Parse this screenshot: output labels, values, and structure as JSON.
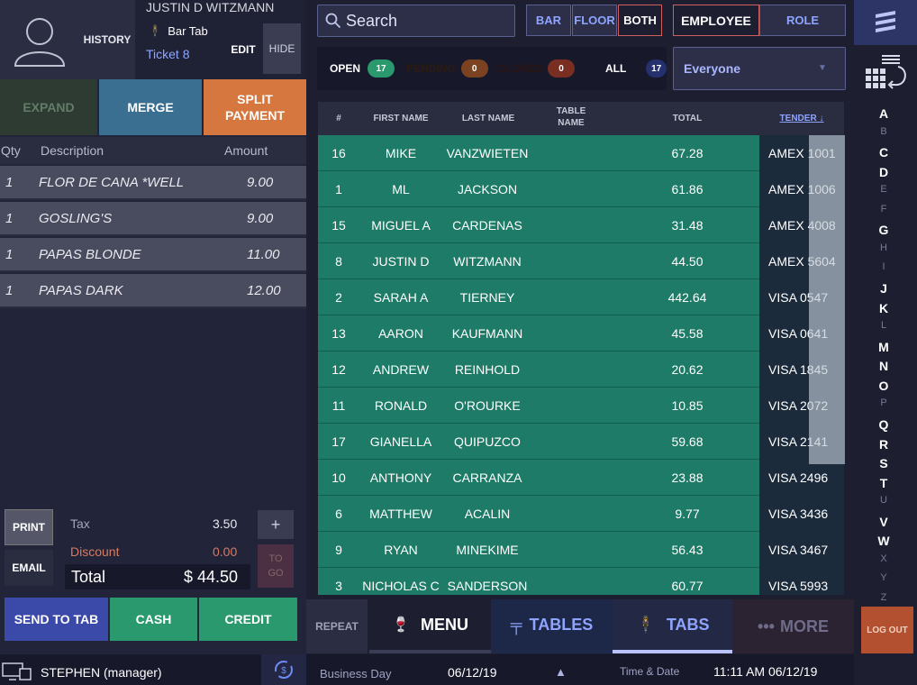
{
  "customer": {
    "name": "JUSTIN D WITZMANN",
    "tab": "Bar Tab",
    "ticket": "Ticket 8"
  },
  "left_buttons": {
    "history": "HISTORY",
    "edit": "EDIT",
    "hide": "HIDE",
    "expand": "EXPAND",
    "merge": "MERGE",
    "split1": "SPLIT",
    "split2": "PAYMENT"
  },
  "order_header": {
    "qty": "Qty",
    "desc": "Description",
    "amt": "Amount"
  },
  "order_items": [
    {
      "qty": "1",
      "desc": "FLOR DE CANA *WELL",
      "amt": "9.00"
    },
    {
      "qty": "1",
      "desc": "GOSLING'S",
      "amt": "9.00"
    },
    {
      "qty": "1",
      "desc": "PAPAS BLONDE",
      "amt": "11.00"
    },
    {
      "qty": "1",
      "desc": "PAPAS DARK",
      "amt": "12.00"
    }
  ],
  "totals": {
    "tax_label": "Tax",
    "tax": "3.50",
    "discount_label": "Discount",
    "discount": "0.00",
    "total_label": "Total",
    "total": "$ 44.50",
    "print": "PRINT",
    "email": "EMAIL",
    "plus": "+",
    "togo1": "TO",
    "togo2": "GO"
  },
  "pay_buttons": {
    "send": "SEND TO TAB",
    "cash": "CASH",
    "credit": "CREDIT"
  },
  "user": "STEPHEN (manager)",
  "search": {
    "placeholder": "Search"
  },
  "scope": {
    "bar": "BAR",
    "floor": "FLOOR",
    "both": "BOTH",
    "employee": "EMPLOYEE",
    "role": "ROLE"
  },
  "status_filters": [
    {
      "label": "OPEN",
      "count": "17",
      "color": "#1d1f31"
    },
    {
      "label": "PENDING",
      "count": "0",
      "color": "#d5773f"
    },
    {
      "label": "CLOSED",
      "count": "0",
      "color": "#c9553f"
    },
    {
      "label": "ALL",
      "count": "17",
      "color": "#3b4aa8"
    }
  ],
  "everyone": "Everyone",
  "table_header": {
    "num": "#",
    "first": "FIRST NAME",
    "last": "LAST NAME",
    "table1": "TABLE",
    "table2": "NAME",
    "total": "TOTAL",
    "tender": "TENDER ↓"
  },
  "tabs": [
    {
      "n": "16",
      "first": "MIKE",
      "last": "VANZWIETEN",
      "total": "67.28",
      "tender": "AMEX 1001"
    },
    {
      "n": "1",
      "first": "ML",
      "last": "JACKSON",
      "total": "61.86",
      "tender": "AMEX 1006"
    },
    {
      "n": "15",
      "first": "MIGUEL A",
      "last": "CARDENAS",
      "total": "31.48",
      "tender": "AMEX 4008"
    },
    {
      "n": "8",
      "first": "JUSTIN D",
      "last": "WITZMANN",
      "total": "44.50",
      "tender": "AMEX 5604"
    },
    {
      "n": "2",
      "first": "SARAH A",
      "last": "TIERNEY",
      "total": "442.64",
      "tender": "VISA 0547"
    },
    {
      "n": "13",
      "first": "AARON",
      "last": "KAUFMANN",
      "total": "45.58",
      "tender": "VISA 0641"
    },
    {
      "n": "12",
      "first": "ANDREW",
      "last": "REINHOLD",
      "total": "20.62",
      "tender": "VISA 1845"
    },
    {
      "n": "11",
      "first": "RONALD",
      "last": "O'ROURKE",
      "total": "10.85",
      "tender": "VISA 2072"
    },
    {
      "n": "17",
      "first": "GIANELLA",
      "last": "QUIPUZCO",
      "total": "59.68",
      "tender": "VISA 2141"
    },
    {
      "n": "10",
      "first": "ANTHONY",
      "last": "CARRANZA",
      "total": "23.88",
      "tender": "VISA 2496"
    },
    {
      "n": "6",
      "first": "MATTHEW",
      "last": "ACALIN",
      "total": "9.77",
      "tender": "VISA 3436"
    },
    {
      "n": "9",
      "first": "RYAN",
      "last": "MINEKIME",
      "total": "56.43",
      "tender": "VISA 3467"
    },
    {
      "n": "3",
      "first": "NICHOLAS C",
      "last": "SANDERSON",
      "total": "60.77",
      "tender": "VISA 5993"
    }
  ],
  "nav": {
    "repeat": "REPEAT",
    "menu": "MENU",
    "tables": "TABLES",
    "tabs": "TABS",
    "more": "MORE"
  },
  "footer": {
    "business_day_label": "Business Day",
    "business_day": "06/12/19",
    "time_label": "Time & Date",
    "time": "11:11 AM 06/12/19"
  },
  "alphabet": [
    "A",
    "B",
    "C",
    "D",
    "E",
    "F",
    "G",
    "H",
    "I",
    "J",
    "K",
    "L",
    "M",
    "N",
    "O",
    "P",
    "Q",
    "R",
    "S",
    "T",
    "U",
    "V",
    "W",
    "X",
    "Y",
    "Z"
  ],
  "alpha_active": [
    "A",
    "C",
    "D",
    "G",
    "J",
    "K",
    "M",
    "N",
    "O",
    "Q",
    "R",
    "S",
    "T",
    "V",
    "W"
  ],
  "logout": "LOG OUT"
}
